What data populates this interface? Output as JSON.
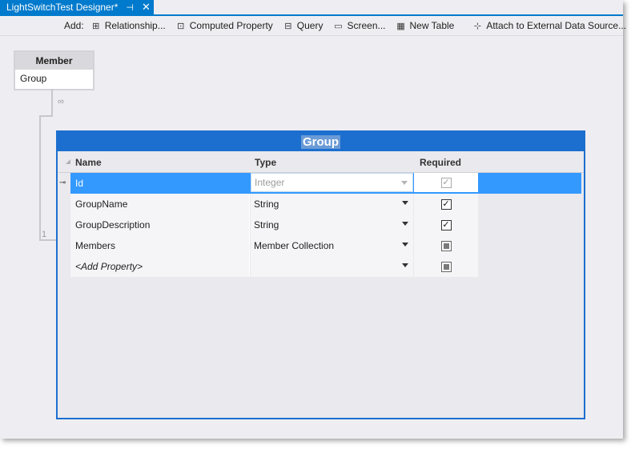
{
  "window": {
    "tab_title": "LightSwitchTest Designer*",
    "tab_pin_icon": "pin-icon",
    "tab_close_icon": "close-icon"
  },
  "toolbar": {
    "add_label": "Add:",
    "buttons": [
      {
        "label": "Relationship...",
        "icon": "relationship-icon"
      },
      {
        "label": "Computed Property",
        "icon": "computed-property-icon"
      },
      {
        "label": "Query",
        "icon": "query-icon"
      },
      {
        "label": "Screen...",
        "icon": "screen-icon"
      },
      {
        "label": "New Table",
        "icon": "new-table-icon"
      },
      {
        "label": "Attach to External Data Source...",
        "icon": "attach-data-source-icon"
      }
    ]
  },
  "member_entity": {
    "title": "Member",
    "property": "Group"
  },
  "relationship": {
    "many_symbol": "∞",
    "one_symbol": "1"
  },
  "group_entity": {
    "title": "Group",
    "columns": {
      "name": "Name",
      "type": "Type",
      "required": "Required"
    },
    "rows": [
      {
        "name": "Id",
        "type": "Integer",
        "required": "checked",
        "key": true
      },
      {
        "name": "GroupName",
        "type": "String",
        "required": "checked"
      },
      {
        "name": "GroupDescription",
        "type": "String",
        "required": "checked"
      },
      {
        "name": "Members",
        "type": "Member Collection",
        "required": "indeterminate"
      },
      {
        "name": "<Add Property>",
        "type": "",
        "required": "indeterminate"
      }
    ]
  },
  "colors": {
    "accent": "#007acc",
    "entity_header": "#1c6fcf",
    "selected_row": "#3399ff"
  }
}
